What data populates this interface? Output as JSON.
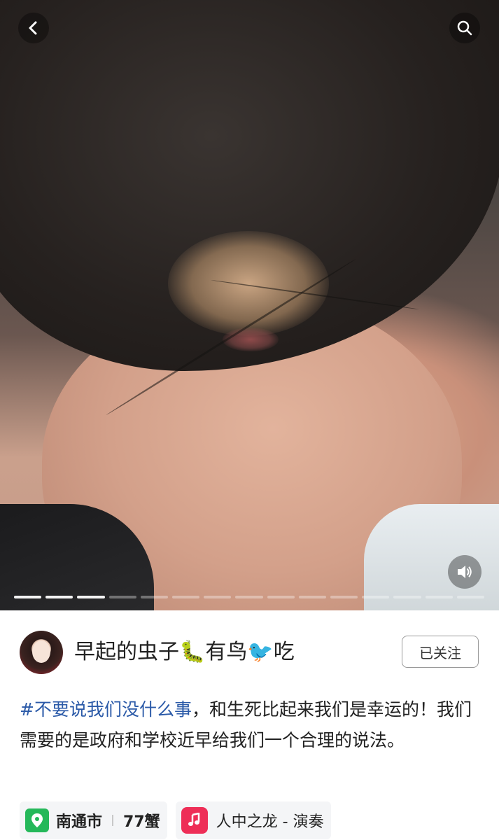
{
  "navigation": {
    "back_icon": "chevron-left-icon",
    "search_icon": "search-icon"
  },
  "media": {
    "sound_icon": "speaker-icon",
    "progress": {
      "total_segments": 15,
      "active_segments": [
        1,
        2,
        3
      ]
    }
  },
  "author": {
    "name": "早起的虫子🐛有鸟🐦吃",
    "follow_label": "已关注"
  },
  "caption": {
    "hashtag": "#不要说我们没什么事",
    "text": "，和生死比起来我们是幸运的！我们需要的是政府和学校近早给我们一个合理的说法。"
  },
  "tags": {
    "location": {
      "icon": "map-pin-icon",
      "city": "南通市",
      "extra": "77蟹"
    },
    "music": {
      "icon": "music-note-icon",
      "label": "人中之龙 - 演奏"
    }
  },
  "colors": {
    "hashtag": "#2b5aa8",
    "location_icon_bg": "#25b85a",
    "music_icon_bg": "#ee2e57"
  }
}
